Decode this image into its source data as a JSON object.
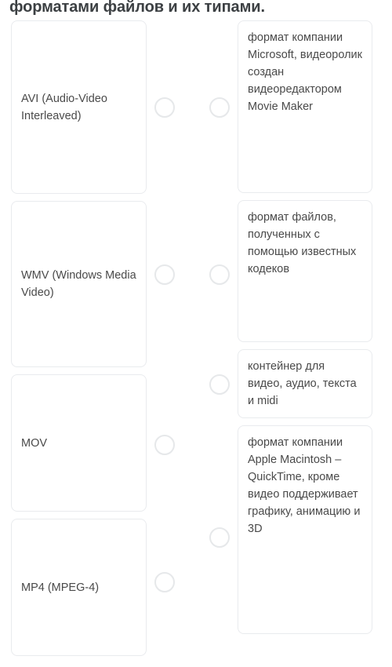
{
  "header": {
    "title": "форматами файлов и их типами."
  },
  "colors": {
    "page_background": "#ffffff",
    "card_background": "#ffffff",
    "card_border": "#e9ebee",
    "title_text": "#3c4043",
    "card_text": "#4a4a4a",
    "radio_border": "#e6e8ea"
  },
  "exercise": {
    "left_column": {
      "items": [
        {
          "label": "AVI (Audio-Video Interleaved)",
          "radio": "radio-unselected"
        },
        {
          "label": "WMV (Windows Media Video)",
          "radio": "radio-unselected"
        },
        {
          "label": "MOV",
          "radio": "radio-unselected"
        },
        {
          "label": "MP4 (MPEG-4)",
          "radio": "radio-unselected"
        }
      ]
    },
    "right_column": {
      "items": [
        {
          "label": "формат компании Microsoft, видеоролик создан видеоредактором Movie Maker",
          "radio": "radio-unselected"
        },
        {
          "label": "формат файлов, полученных с помощью известных кодеков",
          "radio": "radio-unselected"
        },
        {
          "label": "контейнер для видео, аудио, текста и midi",
          "radio": "radio-unselected"
        },
        {
          "label": "формат компании Apple Macintosh – QuickTime, кроме видео поддерживает графику, анимацию и 3D",
          "radio": "radio-unselected"
        }
      ]
    }
  }
}
